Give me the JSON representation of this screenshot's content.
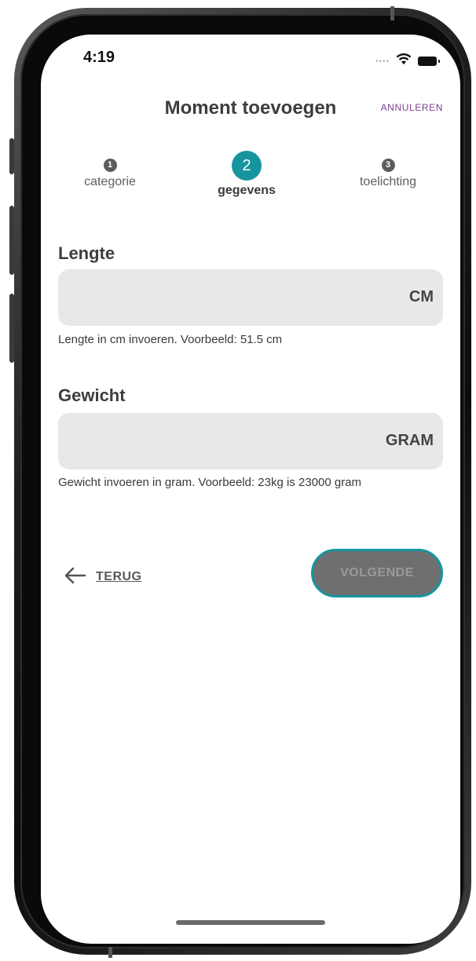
{
  "status_bar": {
    "time": "4:19",
    "signal_icon": "signal-dots-icon",
    "wifi_icon": "wifi-icon",
    "battery_icon": "battery-icon"
  },
  "header": {
    "title": "Moment toevoegen",
    "cancel_label": "ANNULEREN"
  },
  "stepper": {
    "steps": [
      {
        "number": "1",
        "label": "categorie",
        "active": false
      },
      {
        "number": "2",
        "label": "gegevens",
        "active": true
      },
      {
        "number": "3",
        "label": "toelichting",
        "active": false
      }
    ]
  },
  "form": {
    "length": {
      "label": "Lengte",
      "value": "",
      "unit": "CM",
      "hint": "Lengte in cm invoeren. Voorbeeld: 51.5 cm"
    },
    "weight": {
      "label": "Gewicht",
      "value": "",
      "unit": "GRAM",
      "hint": "Gewicht invoeren in gram. Voorbeeld: 23kg is 23000 gram"
    }
  },
  "actions": {
    "back_icon": "arrow-left-icon",
    "back_label": "TERUG",
    "next_label": "VOLGENDE"
  },
  "colors": {
    "accent": "#17959f",
    "cancel_link": "#7b3f8e",
    "field_background": "#e8e8e8",
    "next_button_fill": "#6f6f6f"
  }
}
